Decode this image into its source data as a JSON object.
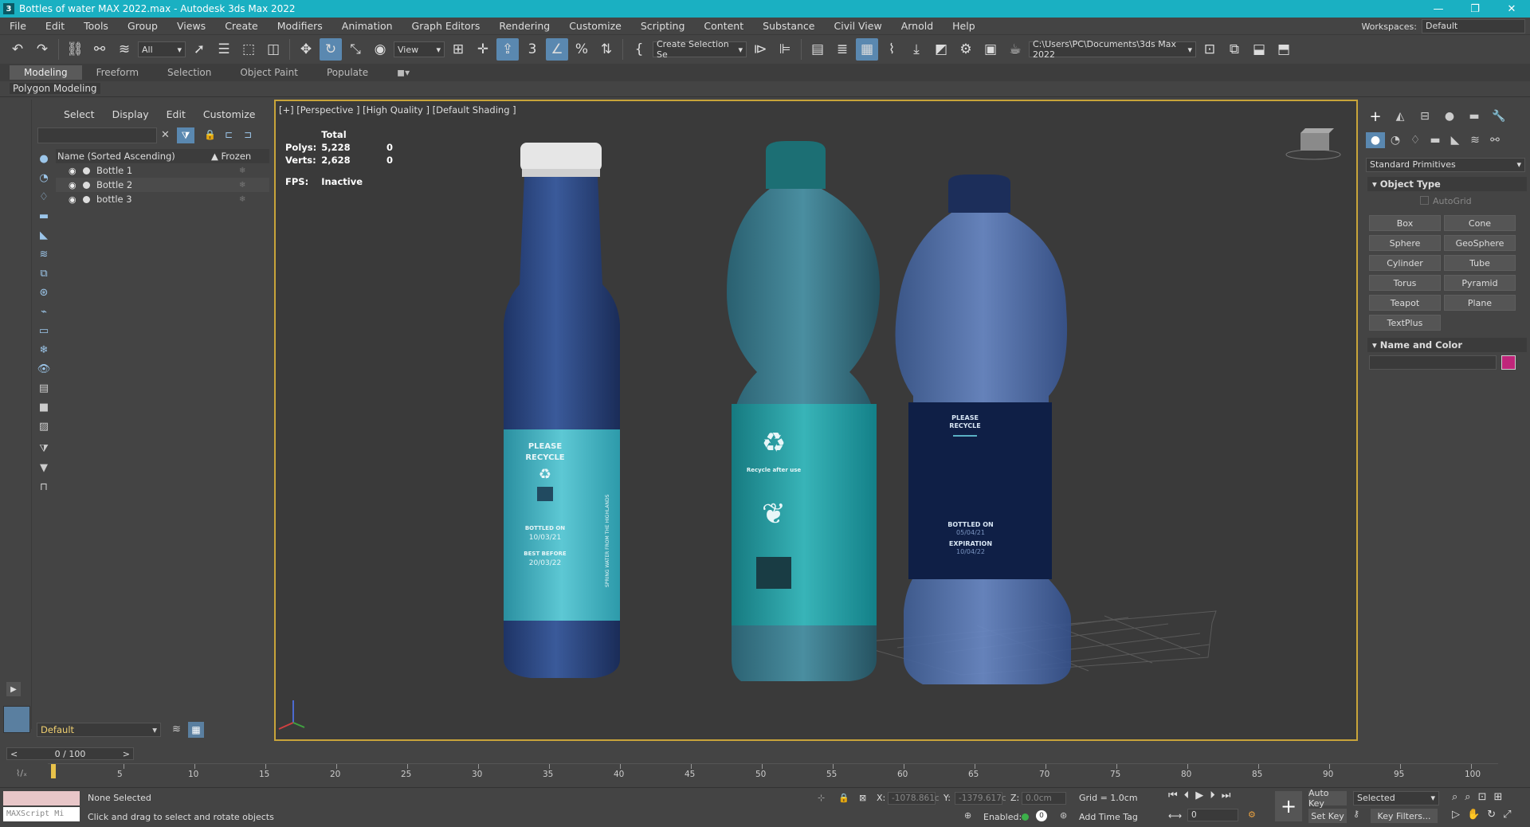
{
  "window": {
    "title": "Bottles of water MAX 2022.max - Autodesk 3ds Max 2022",
    "app_icon": "3"
  },
  "menu": [
    "File",
    "Edit",
    "Tools",
    "Group",
    "Views",
    "Create",
    "Modifiers",
    "Animation",
    "Graph Editors",
    "Rendering",
    "Customize",
    "Scripting",
    "Content",
    "Substance",
    "Civil View",
    "Arnold",
    "Help"
  ],
  "workspace": {
    "label": "Workspaces:",
    "value": "Default"
  },
  "toolbar": {
    "selection_filter": "All",
    "ref_coord": "View",
    "named_selection": "Create Selection Se",
    "project_path": "C:\\Users\\PC\\Documents\\3ds Max 2022"
  },
  "ribbon": {
    "tabs": [
      "Modeling",
      "Freeform",
      "Selection",
      "Object Paint",
      "Populate"
    ],
    "active": "Modeling",
    "panel": "Polygon Modeling"
  },
  "scene_explorer": {
    "menus": [
      "Select",
      "Display",
      "Edit",
      "Customize"
    ],
    "col_name": "Name (Sorted Ascending)",
    "col_frozen": "▲ Frozen",
    "items": [
      "Bottle 1",
      "Bottle 2",
      "bottle 3"
    ],
    "layer": "Default"
  },
  "viewport": {
    "label": "[+] [Perspective ] [High Quality ] [Default Shading ]",
    "stats_header": "Total",
    "polys_label": "Polys:",
    "polys": "5,228",
    "polys_sel": "0",
    "verts_label": "Verts:",
    "verts": "2,628",
    "verts_sel": "0",
    "fps_label": "FPS:",
    "fps": "Inactive"
  },
  "bottles": {
    "b1": {
      "l1": "PLEASE",
      "l2": "RECYCLE",
      "l3": "BOTTLED ON",
      "l4": "10/03/21",
      "l5": "BEST BEFORE",
      "l6": "20/03/22",
      "side": "SPRING WATER FROM THE HIGHLANDS"
    },
    "b2": {
      "l1": "Recycle after use"
    },
    "b3": {
      "l1": "PLEASE",
      "l2": "RECYCLE",
      "l3": "BOTTLED ON",
      "l4": "05/04/21",
      "l5": "EXPIRATION",
      "l6": "10/04/22"
    }
  },
  "command_panel": {
    "category": "Standard Primitives",
    "object_type": "Object Type",
    "autogrid": "AutoGrid",
    "buttons": [
      "Box",
      "Cone",
      "Sphere",
      "GeoSphere",
      "Cylinder",
      "Tube",
      "Torus",
      "Pyramid",
      "Teapot",
      "Plane",
      "TextPlus"
    ],
    "name_color": "Name and Color",
    "swatch_color": "#c0257a"
  },
  "timeline": {
    "frame": "0 / 100",
    "ticks": [
      "5",
      "10",
      "15",
      "20",
      "25",
      "30",
      "35",
      "40",
      "45",
      "50",
      "55",
      "60",
      "65",
      "70",
      "75",
      "80",
      "85",
      "90",
      "95",
      "100"
    ]
  },
  "status": {
    "maxscript": "MAXScript Mi",
    "selection": "None Selected",
    "prompt": "Click and drag to select and rotate objects",
    "x_label": "X:",
    "x": "-1078.861c",
    "y_label": "Y:",
    "y": "-1379.617c",
    "z_label": "Z:",
    "z": "0.0cm",
    "grid": "Grid = 1.0cm",
    "enabled": "Enabled:",
    "add_time_tag": "Add Time Tag",
    "auto_key": "Auto Key",
    "set_key": "Set Key",
    "key_mode": "Selected",
    "key_filters": "Key Filters...",
    "frame_field": "0"
  }
}
